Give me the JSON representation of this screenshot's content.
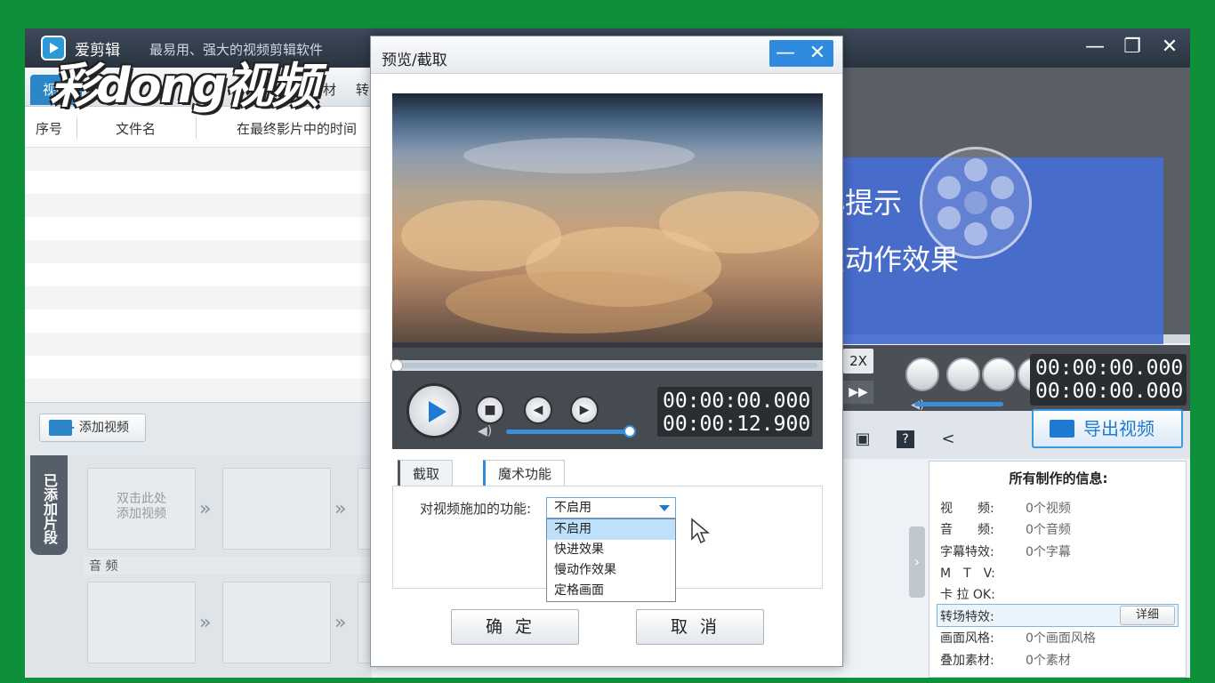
{
  "app": {
    "title": "爱剪辑",
    "subtitle": "最易用、强大的视频剪辑软件",
    "window_controls": [
      "—",
      "❐",
      "✕"
    ]
  },
  "watermark": "彩dong视频",
  "tabs": [
    {
      "label": "视频",
      "active": true
    },
    {
      "label": "叠加素材",
      "active": false
    },
    {
      "label": "转",
      "active": false
    }
  ],
  "list": {
    "headers": [
      "序号",
      "文件名",
      "在最终影片中的时间"
    ]
  },
  "add_video_label": "添加视频",
  "timeline": {
    "side_tab": "已添加片段",
    "clip_placeholder": "双击此处\n添加视频",
    "audio_label": "音 频"
  },
  "dialog": {
    "title": "预览/截取",
    "time_current": "00:00:00.000",
    "time_total": "00:00:12.900",
    "tabs": [
      {
        "label": "截取",
        "active": false
      },
      {
        "label": "魔术功能",
        "active": true
      }
    ],
    "magic_label": "对视频施加的功能:",
    "select_value": "不启用",
    "options": [
      "不启用",
      "快进效果",
      "慢动作效果",
      "定格画面"
    ],
    "ok": "确定",
    "cancel": "取消"
  },
  "right_player": {
    "time_current": "00:00:00.000",
    "time_total": "00:00:00.000",
    "speed": "2X",
    "export": "导出视频"
  },
  "tip": {
    "line1": "小提示",
    "line2": "慢动作效果"
  },
  "info": {
    "title": "所有制作的信息:",
    "rows": [
      {
        "label": "视　　频:",
        "value": "0个视频"
      },
      {
        "label": "音　　频:",
        "value": "0个音频"
      },
      {
        "label": "字幕特效:",
        "value": "0个字幕"
      },
      {
        "label": "M　T　V:",
        "value": ""
      },
      {
        "label": "卡 拉 OK:",
        "value": ""
      },
      {
        "label": "转场特效:",
        "value": ""
      },
      {
        "label": "画面风格:",
        "value": "0个画面风格"
      },
      {
        "label": "叠加素材:",
        "value": "0个素材"
      }
    ],
    "detail_btn": "详细"
  }
}
